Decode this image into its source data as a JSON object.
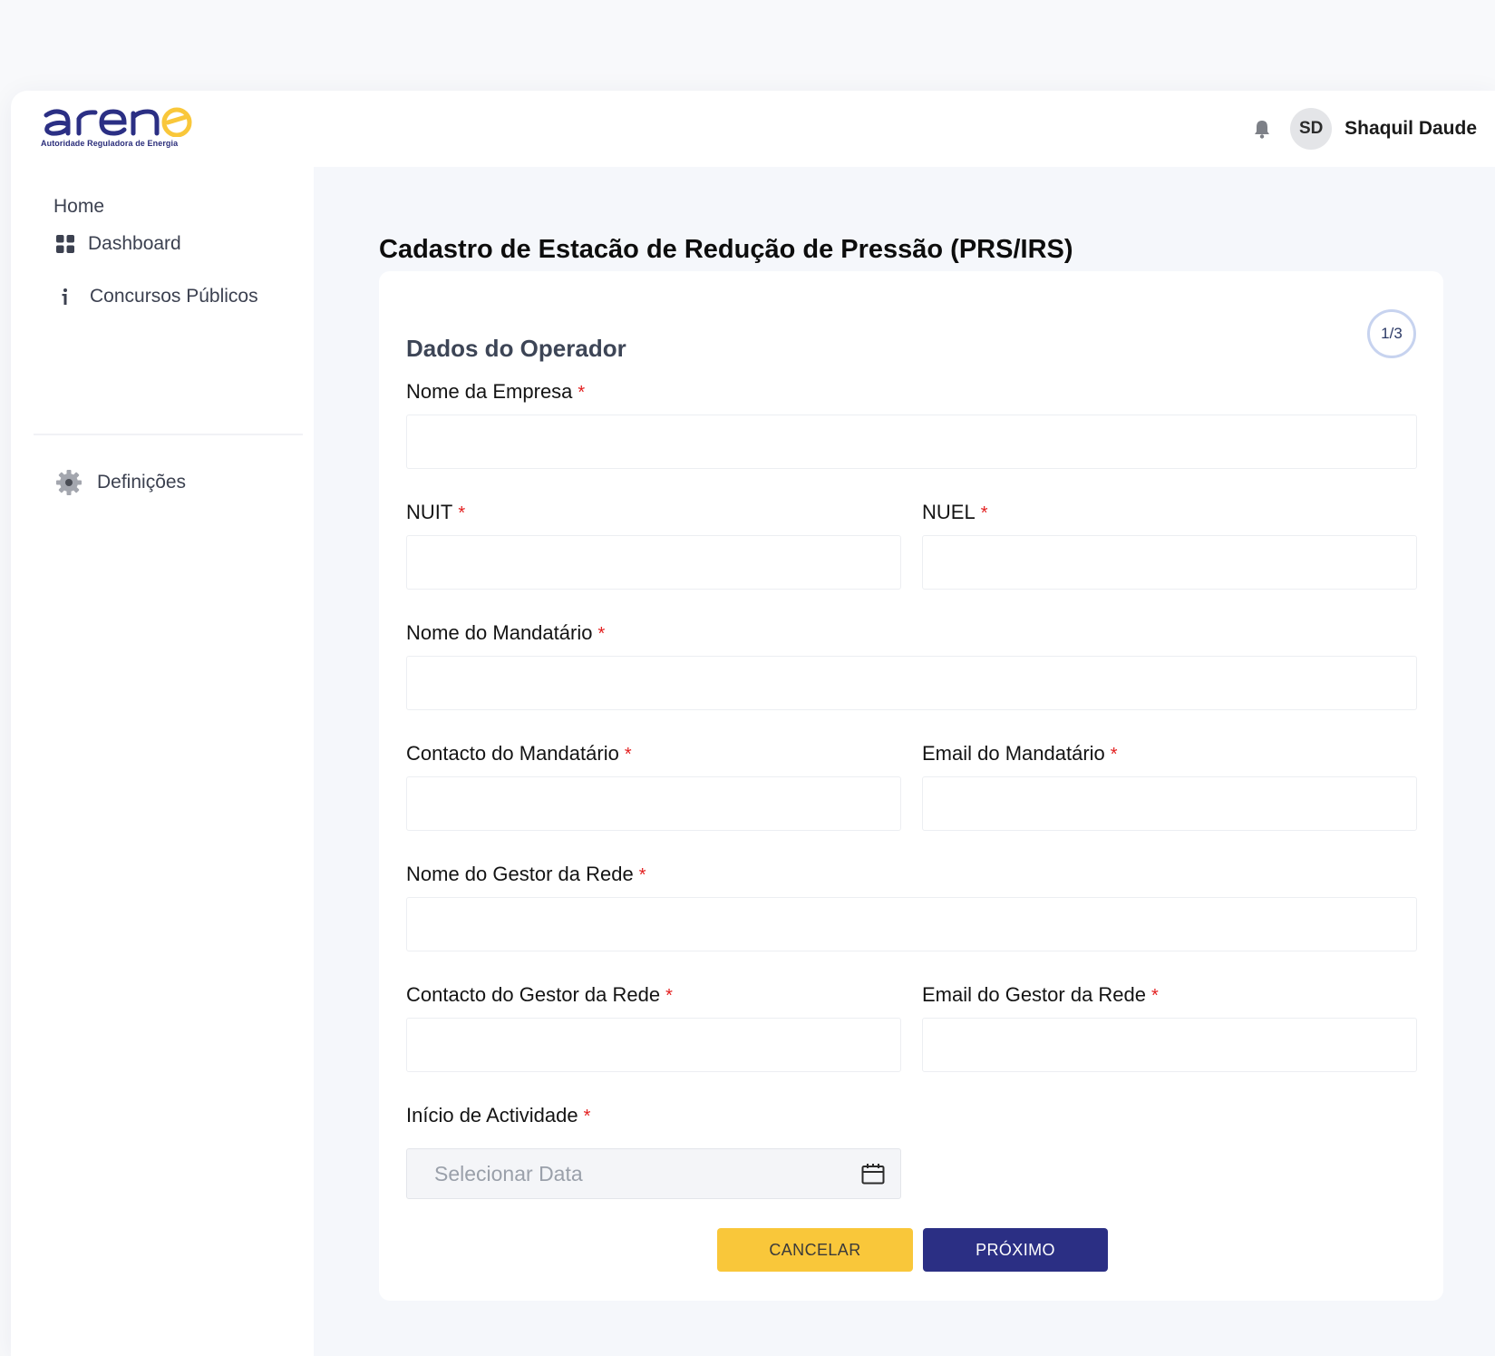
{
  "header": {
    "logo_text": "arene",
    "logo_subtitle": "Autoridade Reguladora de Energia",
    "avatar_initials": "SD",
    "user_name": "Shaquil Daude",
    "notification_icon": "bell-icon"
  },
  "sidebar": {
    "section_label": "Home",
    "items": [
      {
        "label": "Dashboard",
        "icon": "grid-icon"
      },
      {
        "label": "Concursos Públicos",
        "icon": "info-icon"
      },
      {
        "label": "Definições",
        "icon": "gear-icon"
      }
    ]
  },
  "main": {
    "page_title": "Cadastro de Estacão de Redução de Pressão (PRS/IRS)",
    "step": "1/3",
    "section_title": "Dados do Operador",
    "required_marker": "*",
    "fields": {
      "nome_empresa": {
        "label": "Nome da Empresa",
        "value": ""
      },
      "nuit": {
        "label": "NUIT",
        "value": ""
      },
      "nuel": {
        "label": "NUEL",
        "value": ""
      },
      "nome_mandatario": {
        "label": "Nome do Mandatário",
        "value": ""
      },
      "contacto_mandatario": {
        "label": "Contacto do Mandatário",
        "value": ""
      },
      "email_mandatario": {
        "label": "Email do Mandatário",
        "value": ""
      },
      "nome_gestor": {
        "label": "Nome do Gestor da Rede",
        "value": ""
      },
      "contacto_gestor": {
        "label": "Contacto do Gestor da Rede",
        "value": ""
      },
      "email_gestor": {
        "label": "Email do Gestor da Rede",
        "value": ""
      },
      "inicio_actividade": {
        "label": "Início de Actividade",
        "placeholder": "Selecionar Data"
      }
    },
    "buttons": {
      "cancel": "CANCELAR",
      "next": "PRÓXIMO"
    }
  },
  "colors": {
    "brand_navy": "#2b2f84",
    "brand_yellow": "#f9c73a",
    "required_red": "#e32020"
  }
}
